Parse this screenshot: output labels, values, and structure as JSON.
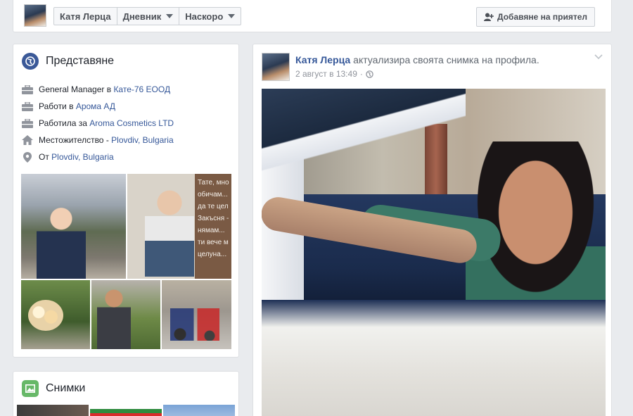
{
  "header": {
    "crumbs": [
      {
        "label": "Катя Лерца",
        "dropdown": false
      },
      {
        "label": "Дневник",
        "dropdown": true
      },
      {
        "label": "Наскоро",
        "dropdown": true
      }
    ],
    "add_friend": "Добавяне на приятел"
  },
  "intro": {
    "title": "Представяне",
    "items": [
      {
        "icon": "briefcase-icon",
        "text": "General Manager в ",
        "link": "Кате-76 ЕООД"
      },
      {
        "icon": "briefcase-icon",
        "text": "Работи в ",
        "link": "Арома АД"
      },
      {
        "icon": "briefcase-icon",
        "text": "Работила за ",
        "link": "Aroma Cosmetics LTD"
      },
      {
        "icon": "home-icon",
        "text": "Местожителство - ",
        "link": "Plovdiv, Bulgaria"
      },
      {
        "icon": "location-pin-icon",
        "text": "От ",
        "link": "Plovdiv, Bulgaria"
      }
    ],
    "quote_text": "Тате, мно\nобичам...\nда те цел\nЗакъсня -\nнямам...\nти вече м\nцелуна..."
  },
  "photos_section": {
    "title": "Снимки"
  },
  "post": {
    "author": "Катя Лерца",
    "action": "актуализира своята снимка на профила.",
    "time": "2 август в 13:49",
    "privacy_icon": "globe-icon"
  },
  "colors": {
    "link": "#365899",
    "background": "#e9ebee",
    "intro_icon": "#3b5998",
    "photos_icon": "#67b868"
  }
}
